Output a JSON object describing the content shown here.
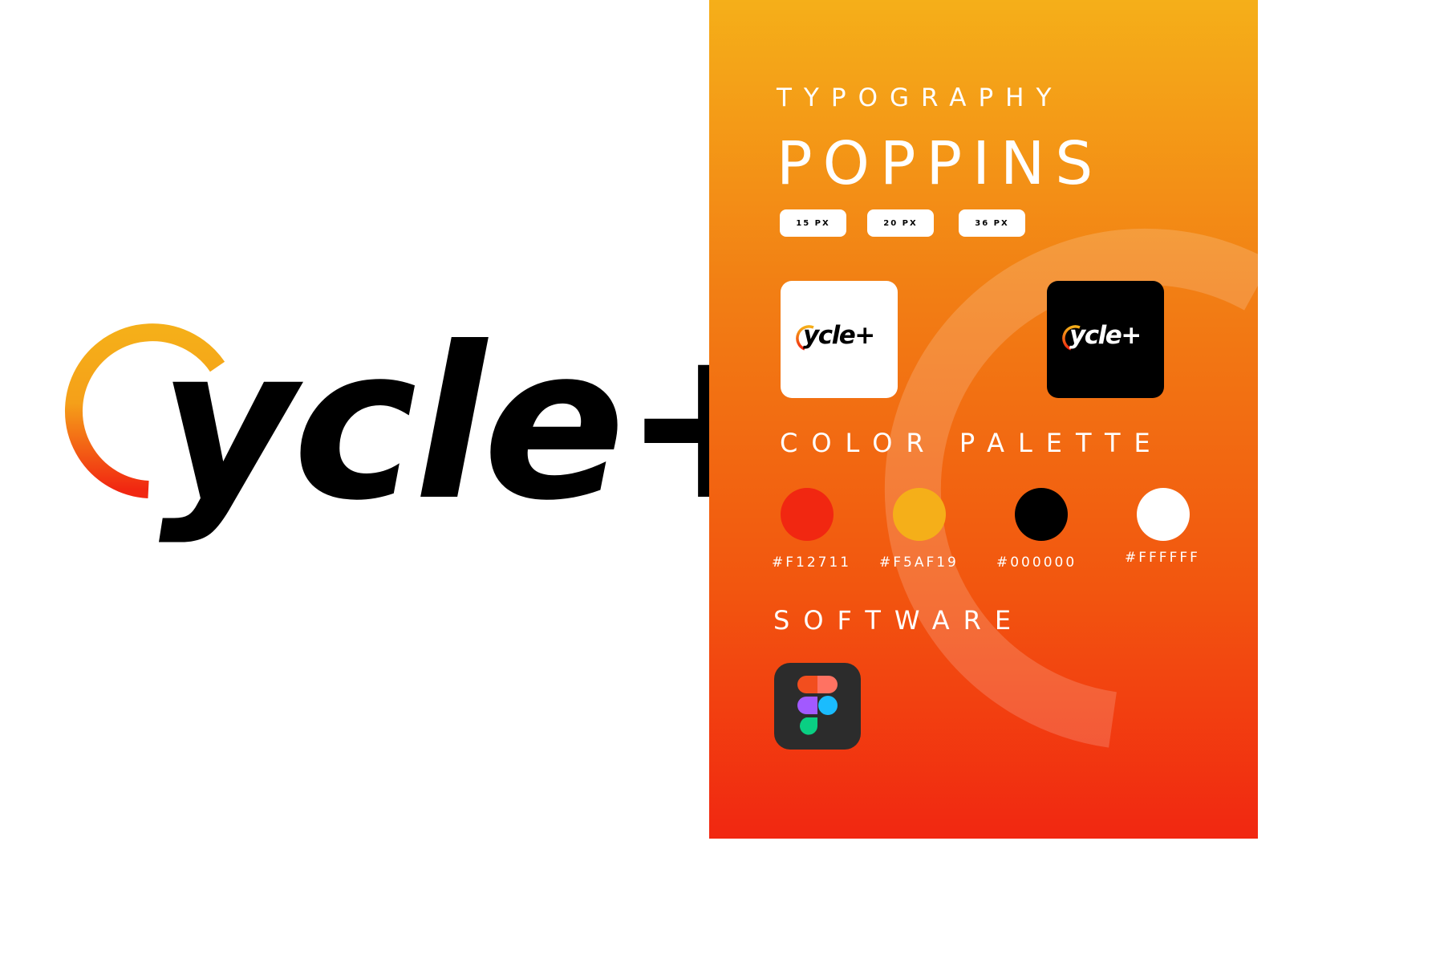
{
  "logo": {
    "wordmark": "ycle+",
    "colors": {
      "ring_start": "#F5AF19",
      "ring_end": "#F12711",
      "text": "#000000"
    }
  },
  "typography": {
    "heading": "TYPOGRAPHY",
    "font_name": "POPPINS",
    "sizes": [
      "15 PX",
      "20 PX",
      "36 PX"
    ]
  },
  "app_icons": [
    {
      "variant": "light",
      "label": "ycle+",
      "background": "#FFFFFF",
      "text_color": "#000000"
    },
    {
      "variant": "dark",
      "label": "ycle+",
      "background": "#000000",
      "text_color": "#FFFFFF"
    }
  ],
  "color_palette": {
    "heading": "COLOR PALETTE",
    "colors": [
      {
        "hex": "#F12711",
        "label": "#F12711"
      },
      {
        "hex": "#F5AF19",
        "label": "#F5AF19"
      },
      {
        "hex": "#000000",
        "label": "#000000"
      },
      {
        "hex": "#FFFFFF",
        "label": "#FFFFFF"
      }
    ]
  },
  "software": {
    "heading": "SOFTWARE",
    "tools": [
      {
        "icon": "figma-icon"
      }
    ]
  }
}
